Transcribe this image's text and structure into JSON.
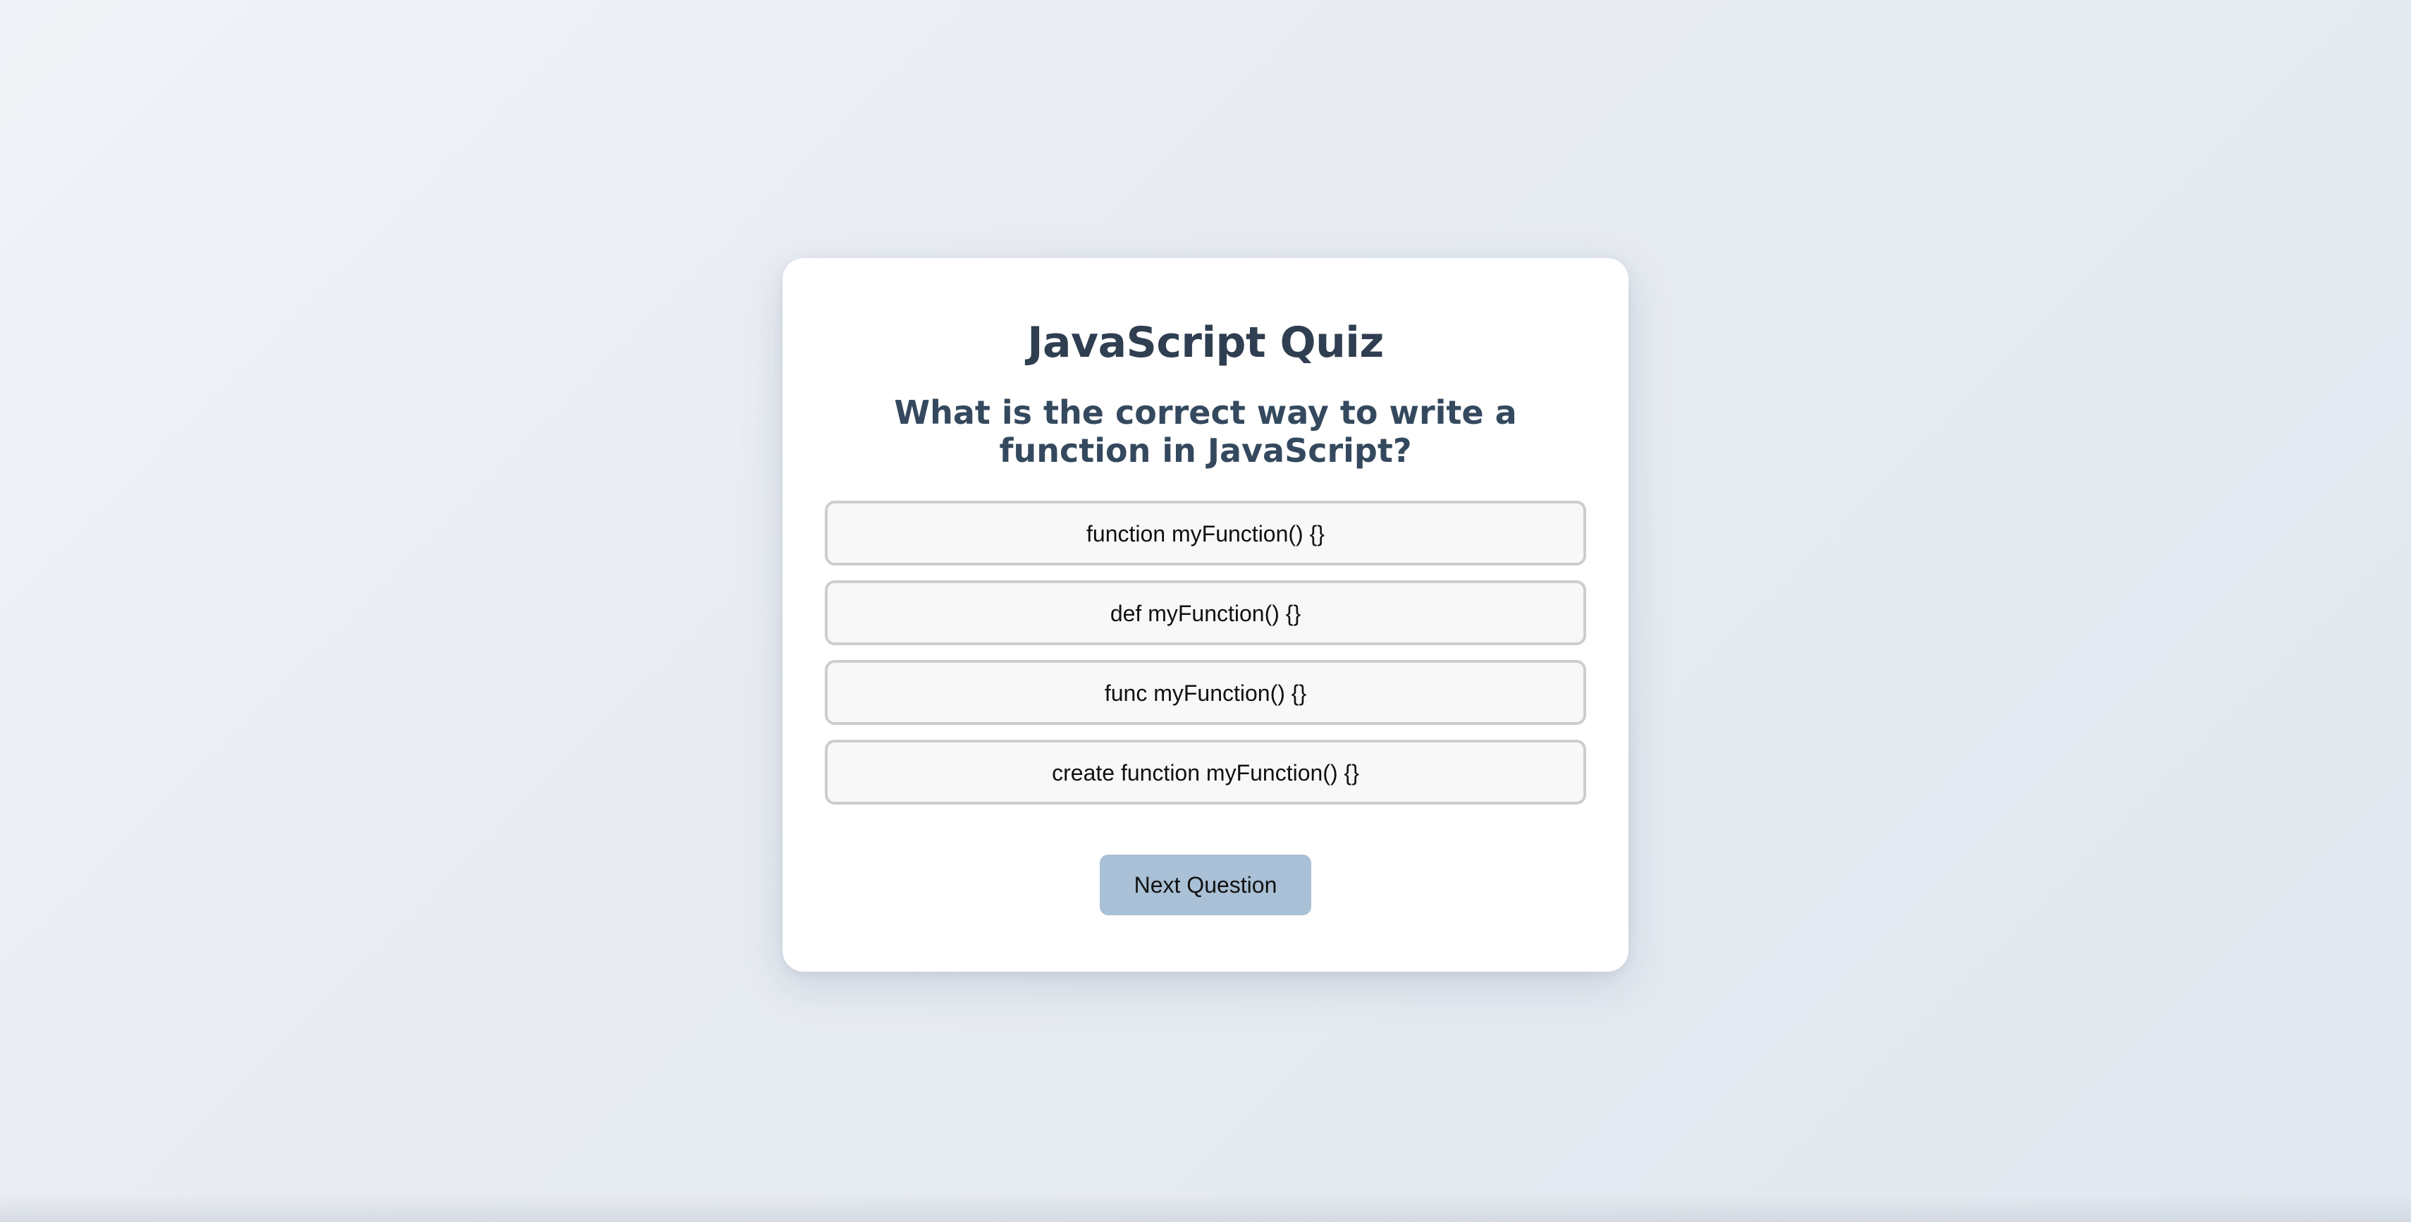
{
  "quiz": {
    "title": "JavaScript Quiz",
    "question": "What is the correct way to write a function in JavaScript?",
    "options": [
      "function myFunction() {}",
      "def myFunction() {}",
      "func myFunction() {}",
      "create function myFunction() {}"
    ],
    "next_label": "Next Question"
  },
  "colors": {
    "title_text": "#2f3e50",
    "question_text": "#34495e",
    "option_background": "#f8f8f8",
    "option_border": "#cdcdcd",
    "next_button_background": "#a9c0d6",
    "card_background": "#ffffff"
  }
}
